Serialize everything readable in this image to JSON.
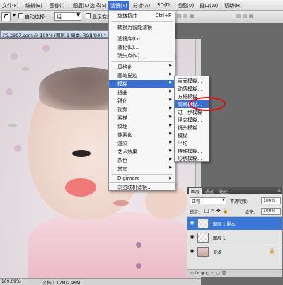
{
  "menubar": {
    "items": [
      "文件(F)",
      "编辑(E)",
      "图像(I)",
      "图层(L)",
      "选择(S)",
      "滤镜(T)",
      "分析(A)",
      "3D(D)",
      "视图(V)",
      "窗口(W)",
      "帮助(H)"
    ]
  },
  "options": {
    "auto_select_label": "自动选择:",
    "auto_select_value": "组",
    "transform_label": "显示变换控件"
  },
  "document": {
    "tab_title": "PS.3987.com @ 109% (图层 1 副本, RGB/8#) *",
    "zoom": "109.09%",
    "doc_info": "文档:1.17M/2.96M"
  },
  "filter_menu": {
    "last_filter": "旋转扭曲",
    "last_filter_shortcut": "Ctrl+F",
    "convert_smart": "转换为智能滤镜",
    "filter_gallery": "滤镜库(G)...",
    "liquify": "液化(L)...",
    "vanishing_point": "消失点(V)...",
    "items": [
      "风格化",
      "画笔描边",
      "模糊",
      "扭曲",
      "锐化",
      "视频",
      "素描",
      "纹理",
      "像素化",
      "渲染",
      "艺术效果",
      "杂色",
      "其它"
    ],
    "digimarc": "Digimarc",
    "browse_online": "浏览联机滤镜..."
  },
  "blur_submenu": {
    "items": [
      "表面模糊...",
      "动感模糊...",
      "方框模糊...",
      "高斯模糊...",
      "进一步模糊",
      "径向模糊...",
      "镜头模糊...",
      "模糊",
      "平均",
      "特殊模糊...",
      "形状模糊..."
    ],
    "selected": "高斯模糊..."
  },
  "layers_panel": {
    "tabs": [
      "图层",
      "通道",
      "路径"
    ],
    "blend_mode": "正常",
    "opacity_label": "不透明度:",
    "opacity_value": "100%",
    "lock_label": "锁定:",
    "fill_label": "填充:",
    "fill_value": "100%",
    "layers": [
      {
        "name": "图层 1 副本",
        "selected": true
      },
      {
        "name": "图层 1",
        "selected": false
      },
      {
        "name": "背景",
        "selected": false
      }
    ]
  },
  "colors": {
    "menu_highlight": "#3b6fcf",
    "annotation_circle": "#dd1111",
    "layer_selected": "#3b78d6"
  }
}
